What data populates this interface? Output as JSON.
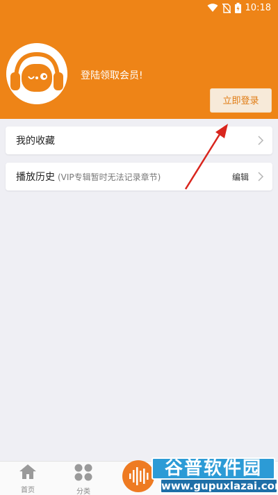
{
  "status_bar": {
    "time": "10:18"
  },
  "header": {
    "login_prompt": "登陆领取会员!",
    "login_button": "立即登录",
    "background_color": "#ee8417"
  },
  "menu": {
    "favorites": {
      "title": "我的收藏"
    },
    "history": {
      "title": "播放历史",
      "subtitle": "(VIP专辑暂时无法记录章节)",
      "edit_label": "编辑"
    }
  },
  "tabbar": {
    "tabs": [
      {
        "label": "首页",
        "icon": "home-icon"
      },
      {
        "label": "分类",
        "icon": "grid-icon"
      },
      {
        "label": "",
        "icon": "audio-wave-icon"
      }
    ],
    "accent_color": "#ee7b22"
  },
  "watermark": {
    "top_text": "谷普软件园",
    "bottom_text": "www.gupuxlazai.com"
  }
}
